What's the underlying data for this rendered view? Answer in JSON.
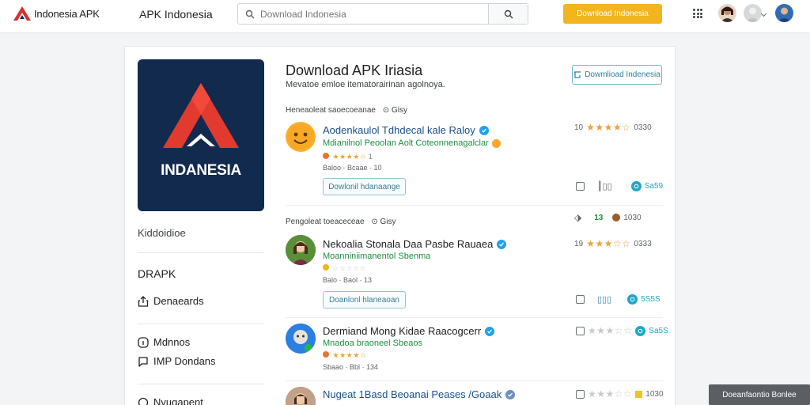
{
  "header": {
    "brand": "Indonesia APK",
    "title": "APK Indonesia",
    "search_placeholder": "Download Indonesia",
    "cta": "Download Indonesia",
    "cta_color": "#f2b51e"
  },
  "sidebar": {
    "logo_text": "INDANESIA",
    "section_label": "Kiddoidioe",
    "heading": "DRAPK",
    "items": [
      {
        "label": "Denaeards",
        "icon": "share-icon"
      },
      {
        "label": "Mdnnos",
        "icon": "info-icon"
      },
      {
        "label": "IMP Dondans",
        "icon": "chat-icon"
      },
      {
        "label": "Nyugapent",
        "icon": "circle-icon"
      }
    ]
  },
  "main": {
    "title": "Download APK Iriasia",
    "subtitle": "Mevatoe emloe itematorairinan agolnoya.",
    "action": "Dowmlioad Indenesia",
    "section1": "Heneaoleat saoecoeanae",
    "section1_tail": "Gisy",
    "section2": "Pengoleat toeaceceae",
    "section2_tail": "Gisy",
    "apps": [
      {
        "name": "Aodenkaulol Tdhdecal kale Raloy",
        "developer": "Mdianilnol Peoolan Aolt Coteonnenagalclar",
        "stars": "★★★★☆",
        "count": "1",
        "meta": "Baloo · Bcaae · 10",
        "button": "Dowlonil hdanaange",
        "top_left": "10",
        "top_stars": "★★★★☆",
        "top_right": "0330",
        "bottom_right": "Sa59"
      },
      {
        "name": "Nekoalia Stonala Daa Pasbe Rauaea",
        "developer": "Moanniniimanentol Sbenma",
        "stars": "☆☆☆☆☆",
        "count": "",
        "meta": "Balo · Baol · 13",
        "button": "Doanlonl hlaneaoan",
        "top_left": "19",
        "top_stars": "★★★☆☆",
        "top_right": "0333",
        "bottom_right": "5S5S"
      },
      {
        "name": "Dermiand Mong Kidae Raacogcerr",
        "developer": "Mnadoa braoneel Sbeaos",
        "stars": "★★★★☆",
        "count": "",
        "meta": "Sbaao · Bbl · 134",
        "button": "",
        "top_left": "",
        "top_stars": "★★★☆☆",
        "top_right": "",
        "bottom_right": "Sa5S"
      },
      {
        "name": "Nugeat 1Basd Beoanai Peases /Goaak",
        "developer": "",
        "stars": "",
        "count": "",
        "meta": "",
        "button": "",
        "top_left": "",
        "top_stars": "★★★☆☆",
        "top_right": "1030",
        "bottom_right": ""
      }
    ],
    "row2_top_right": "1030",
    "row2_top_nums": [
      "13",
      "1030"
    ]
  },
  "toast": "Doeanfaontio Bonlee"
}
